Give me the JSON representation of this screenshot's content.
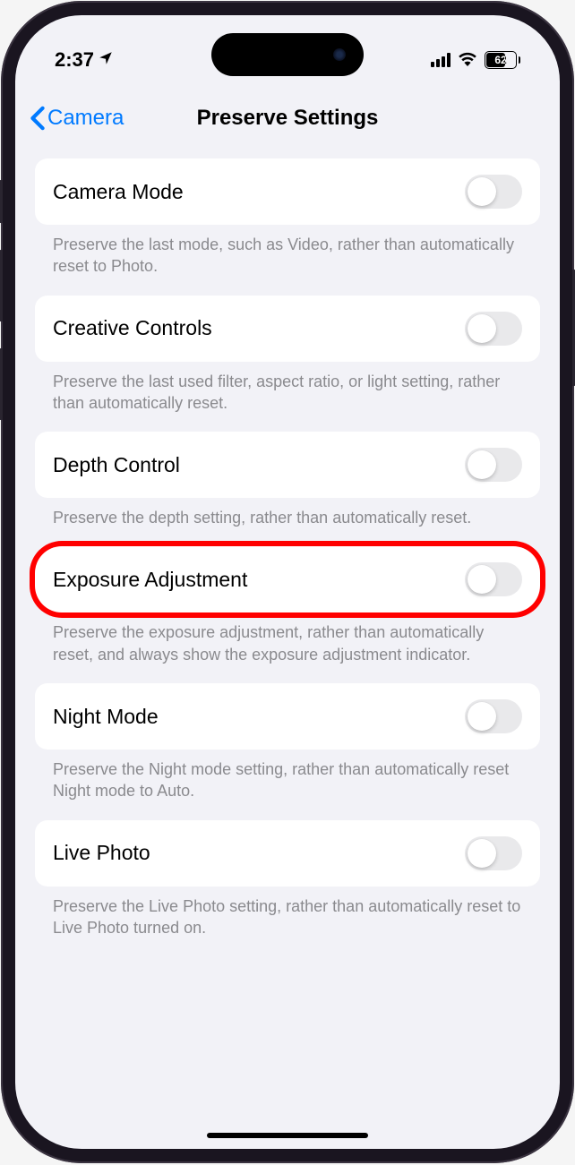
{
  "status": {
    "time": "2:37",
    "battery_percent": "62"
  },
  "nav": {
    "back_label": "Camera",
    "title": "Preserve Settings"
  },
  "settings": [
    {
      "label": "Camera Mode",
      "footer": "Preserve the last mode, such as Video, rather than automatically reset to Photo.",
      "highlighted": false
    },
    {
      "label": "Creative Controls",
      "footer": "Preserve the last used filter, aspect ratio, or light setting, rather than automatically reset.",
      "highlighted": false
    },
    {
      "label": "Depth Control",
      "footer": "Preserve the depth setting, rather than automatically reset.",
      "highlighted": false
    },
    {
      "label": "Exposure Adjustment",
      "footer": "Preserve the exposure adjustment, rather than automatically reset, and always show the exposure adjustment indicator.",
      "highlighted": true
    },
    {
      "label": "Night Mode",
      "footer": "Preserve the Night mode setting, rather than automatically reset Night mode to Auto.",
      "highlighted": false
    },
    {
      "label": "Live Photo",
      "footer": "Preserve the Live Photo setting, rather than automatically reset to Live Photo turned on.",
      "highlighted": false
    }
  ]
}
